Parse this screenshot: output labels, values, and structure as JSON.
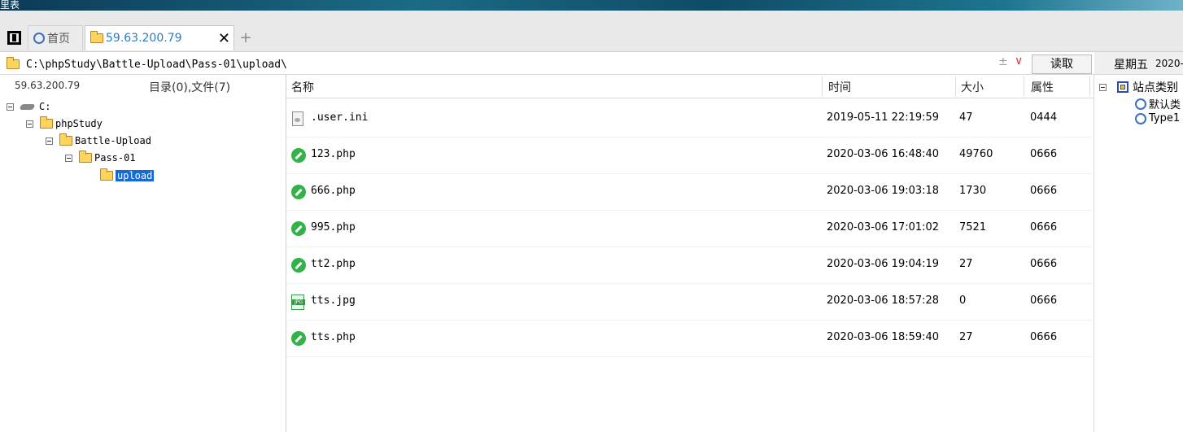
{
  "topstrip": {
    "text": "里表"
  },
  "tabs": {
    "home_label": "首页",
    "site_label": "59.63.200.79",
    "close_glyph": "✕",
    "add_glyph": "+"
  },
  "address": {
    "path": "C:\\phpStudy\\Battle-Upload\\Pass-01\\upload\\",
    "expand_glyph": "±",
    "dropdown_glyph": "∨",
    "read_label": "读取"
  },
  "left": {
    "ip": "59.63.200.79",
    "count": "目录(0),文件(7)",
    "tree": [
      {
        "label": "C:"
      },
      {
        "label": "phpStudy"
      },
      {
        "label": "Battle-Upload"
      },
      {
        "label": "Pass-01"
      },
      {
        "label": "upload"
      }
    ]
  },
  "filelist": {
    "headers": {
      "name": "名称",
      "time": "时间",
      "size": "大小",
      "attr": "属性"
    },
    "rows": [
      {
        "icon": "ini-file-icon",
        "name": ".user.ini",
        "time": "2019-05-11 22:19:59",
        "size": "47",
        "attr": "0444"
      },
      {
        "icon": "php-file-icon",
        "name": "123.php",
        "time": "2020-03-06 16:48:40",
        "size": "49760",
        "attr": "0666"
      },
      {
        "icon": "php-file-icon",
        "name": "666.php",
        "time": "2020-03-06 19:03:18",
        "size": "1730",
        "attr": "0666"
      },
      {
        "icon": "php-file-icon",
        "name": "995.php",
        "time": "2020-03-06 17:01:02",
        "size": "7521",
        "attr": "0666"
      },
      {
        "icon": "php-file-icon",
        "name": "tt2.php",
        "time": "2020-03-06 19:04:19",
        "size": "27",
        "attr": "0666"
      },
      {
        "icon": "jpg-file-icon",
        "name": "tts.jpg",
        "time": "2020-03-06 18:57:28",
        "size": "0",
        "attr": "0666"
      },
      {
        "icon": "php-file-icon",
        "name": "tts.php",
        "time": "2020-03-06 18:59:40",
        "size": "27",
        "attr": "0666"
      }
    ]
  },
  "right": {
    "weekday": "星期五",
    "date": "2020-",
    "root_label": "站点类别",
    "items": [
      {
        "label": "默认类"
      },
      {
        "label": "Type1"
      }
    ]
  }
}
